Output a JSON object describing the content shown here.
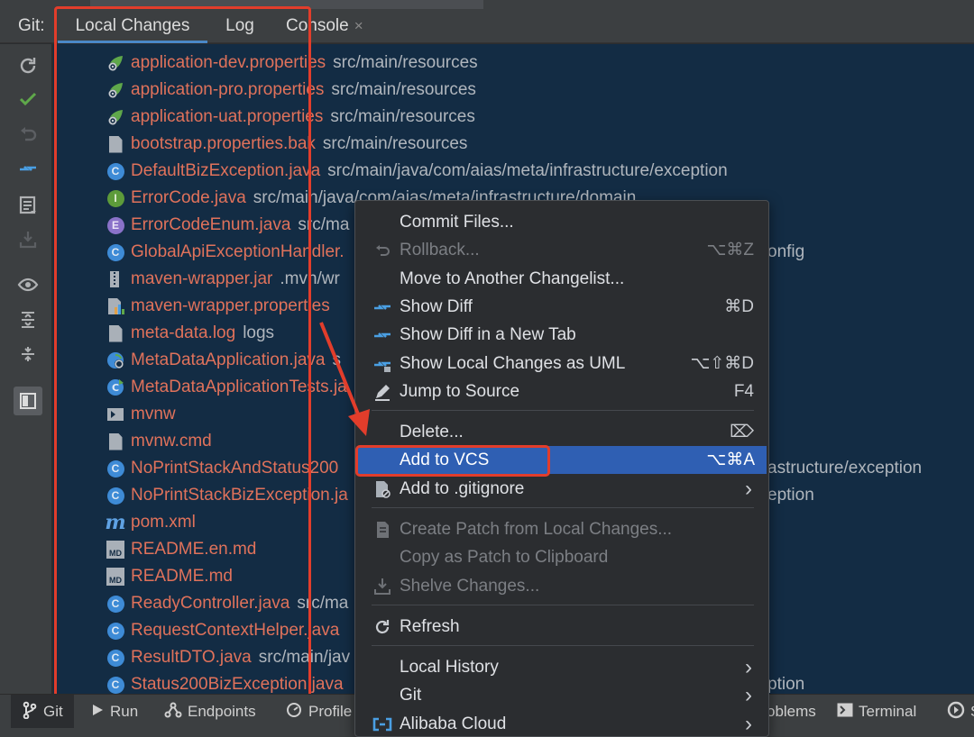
{
  "toolwindow": {
    "prefix": "Git:",
    "tabs": [
      {
        "label": "Local Changes",
        "active": true
      },
      {
        "label": "Log",
        "active": false
      },
      {
        "label": "Console",
        "active": false,
        "closable": true
      }
    ],
    "close_glyph": "×"
  },
  "toolbar_icons": [
    "refresh-icon",
    "commit-check-icon",
    "rollback-icon",
    "show-diff-icon",
    "changelist-icon",
    "shelve-icon",
    "view-options-icon",
    "expand-all-icon",
    "collapse-all-icon",
    "preview-toggle-icon"
  ],
  "files": [
    {
      "name": "application-dev.properties",
      "path": "src/main/resources",
      "icon": "properties-config-icon"
    },
    {
      "name": "application-pro.properties",
      "path": "src/main/resources",
      "icon": "properties-config-icon"
    },
    {
      "name": "application-uat.properties",
      "path": "src/main/resources",
      "icon": "properties-config-icon"
    },
    {
      "name": "bootstrap.properties.bak",
      "path": "src/main/resources",
      "icon": "text-file-icon"
    },
    {
      "name": "DefaultBizException.java",
      "path": "src/main/java/com/aias/meta/infrastructure/exception",
      "icon": "java-class-icon"
    },
    {
      "name": "ErrorCode.java",
      "path": "src/main/java/com/aias/meta/infrastructure/domain",
      "icon": "java-interface-icon"
    },
    {
      "name": "ErrorCodeEnum.java",
      "path": "src/ma",
      "icon": "java-enum-icon"
    },
    {
      "name": "GlobalApiExceptionHandler.",
      "path": "onfig",
      "icon": "java-class-icon"
    },
    {
      "name": "maven-wrapper.jar",
      "path": ".mvn/wr",
      "icon": "jar-archive-icon"
    },
    {
      "name": "maven-wrapper.properties",
      "path": "",
      "icon": "properties-chart-icon"
    },
    {
      "name": "meta-data.log",
      "path": "logs",
      "icon": "text-file-icon"
    },
    {
      "name": "MetaDataApplication.java",
      "path": "s",
      "icon": "spring-boot-class-icon"
    },
    {
      "name": "MetaDataApplicationTests.ja",
      "path": "",
      "icon": "test-class-icon"
    },
    {
      "name": "mvnw",
      "path": "",
      "icon": "shell-script-icon"
    },
    {
      "name": "mvnw.cmd",
      "path": "",
      "icon": "text-file-icon"
    },
    {
      "name": "NoPrintStackAndStatus200",
      "path": "astructure/exception",
      "icon": "java-class-icon"
    },
    {
      "name": "NoPrintStackBizException.ja",
      "path": "eption",
      "icon": "java-class-icon"
    },
    {
      "name": "pom.xml",
      "path": "",
      "icon": "maven-icon"
    },
    {
      "name": "README.en.md",
      "path": "",
      "icon": "markdown-icon"
    },
    {
      "name": "README.md",
      "path": "",
      "icon": "markdown-icon"
    },
    {
      "name": "ReadyController.java",
      "path": "src/ma",
      "icon": "java-class-icon"
    },
    {
      "name": "RequestContextHelper.java",
      "path": "",
      "icon": "java-class-icon"
    },
    {
      "name": "ResultDTO.java",
      "path": "src/main/jav",
      "icon": "java-class-icon"
    },
    {
      "name": "Status200BizException.java",
      "path": "ption",
      "icon": "java-class-icon"
    }
  ],
  "context_menu": {
    "items": [
      {
        "label": "Commit Files...",
        "shortcut": "",
        "icon": "",
        "disabled": false
      },
      {
        "label": "Rollback...",
        "shortcut": "⌥⌘Z",
        "icon": "rollback-icon",
        "disabled": true
      },
      {
        "label": "Move to Another Changelist...",
        "shortcut": "",
        "icon": "",
        "disabled": false
      },
      {
        "label": "Show Diff",
        "shortcut": "⌘D",
        "icon": "show-diff-icon",
        "disabled": false
      },
      {
        "label": "Show Diff in a New Tab",
        "shortcut": "",
        "icon": "show-diff-icon",
        "disabled": false
      },
      {
        "label": "Show Local Changes as UML",
        "shortcut": "⌥⇧⌘D",
        "icon": "uml-diagram-icon",
        "disabled": false
      },
      {
        "label": "Jump to Source",
        "shortcut": "F4",
        "icon": "pencil-icon",
        "disabled": false
      },
      {
        "label": "Delete...",
        "shortcut": "⌦",
        "icon": "",
        "disabled": false
      },
      {
        "label": "Add to VCS",
        "shortcut": "⌥⌘A",
        "icon": "",
        "disabled": false,
        "selected": true
      },
      {
        "label": "Add to .gitignore",
        "shortcut": "›",
        "icon": "gitignore-file-icon",
        "disabled": false
      },
      {
        "label": "Create Patch from Local Changes...",
        "shortcut": "",
        "icon": "patch-icon",
        "disabled": true
      },
      {
        "label": "Copy as Patch to Clipboard",
        "shortcut": "",
        "icon": "",
        "disabled": true
      },
      {
        "label": "Shelve Changes...",
        "shortcut": "",
        "icon": "shelve-icon",
        "disabled": true
      },
      {
        "label": "Refresh",
        "shortcut": "",
        "icon": "refresh-icon",
        "disabled": false
      },
      {
        "label": "Local History",
        "shortcut": "›",
        "icon": "",
        "disabled": false
      },
      {
        "label": "Git",
        "shortcut": "›",
        "icon": "",
        "disabled": false
      },
      {
        "label": "Alibaba Cloud",
        "shortcut": "›",
        "icon": "alibaba-cloud-icon",
        "disabled": false
      }
    ]
  },
  "bottom_tools": [
    {
      "label": "Git",
      "icon": "git-branch-icon",
      "active": true
    },
    {
      "label": "Run",
      "icon": "run-icon",
      "active": false
    },
    {
      "label": "Endpoints",
      "icon": "endpoints-icon",
      "active": false
    },
    {
      "label": "Profile",
      "icon": "profiler-icon",
      "active": false
    },
    {
      "label": "oblems",
      "icon": "",
      "active": false
    },
    {
      "label": "Terminal",
      "icon": "terminal-icon",
      "active": false
    },
    {
      "label": "S",
      "icon": "services-icon",
      "active": false
    }
  ],
  "colors": {
    "file_added_unversioned": "#e0725b",
    "highlight_box": "#e23d2b",
    "menu_selection": "#2f5fb3",
    "list_background": "#132c44",
    "tab_underline": "#4a88c7"
  }
}
